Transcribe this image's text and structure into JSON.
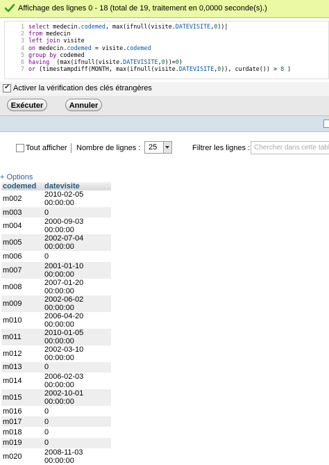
{
  "status": {
    "message": "Affichage des lignes 0 - 18 (total de 19, traitement en 0,0000 seconde(s).)"
  },
  "sql": {
    "line_numbers": [
      "1",
      "2",
      "3",
      "4",
      "5",
      "6",
      "7"
    ]
  },
  "fk_check": {
    "label": "Activer la vérification des clés étrangères",
    "checked": true
  },
  "buttons": {
    "execute": "Exécuter",
    "cancel": "Annuler"
  },
  "controls": {
    "show_all": "Tout afficher",
    "rows_label": "Nombre de lignes :",
    "rows_value": "25",
    "filter_label": "Filtrer les lignes :",
    "filter_placeholder": "Chercher dans cette tabl"
  },
  "options_link": "+ Options",
  "table": {
    "headers": [
      "codemed",
      "datevisite"
    ],
    "rows": [
      [
        "m002",
        "2010-02-05 00:00:00"
      ],
      [
        "m003",
        "0"
      ],
      [
        "m004",
        "2000-09-03 00:00:00"
      ],
      [
        "m005",
        "2002-07-04 00:00:00"
      ],
      [
        "m006",
        "0"
      ],
      [
        "m007",
        "2001-01-10 00:00:00"
      ],
      [
        "m008",
        "2007-01-20 00:00:00"
      ],
      [
        "m009",
        "2002-06-02 00:00:00"
      ],
      [
        "m010",
        "2006-04-20 00:00:00"
      ],
      [
        "m011",
        "2010-01-05 00:00:00"
      ],
      [
        "m012",
        "2002-03-10 00:00:00"
      ],
      [
        "m013",
        "0"
      ],
      [
        "m014",
        "2006-02-03 00:00:00"
      ],
      [
        "m015",
        "2002-10-01 00:00:00"
      ],
      [
        "m016",
        "0"
      ],
      [
        "m017",
        "0"
      ],
      [
        "m018",
        "0"
      ],
      [
        "m019",
        "0"
      ],
      [
        "m020",
        "2008-11-03 00:00:00"
      ]
    ]
  }
}
